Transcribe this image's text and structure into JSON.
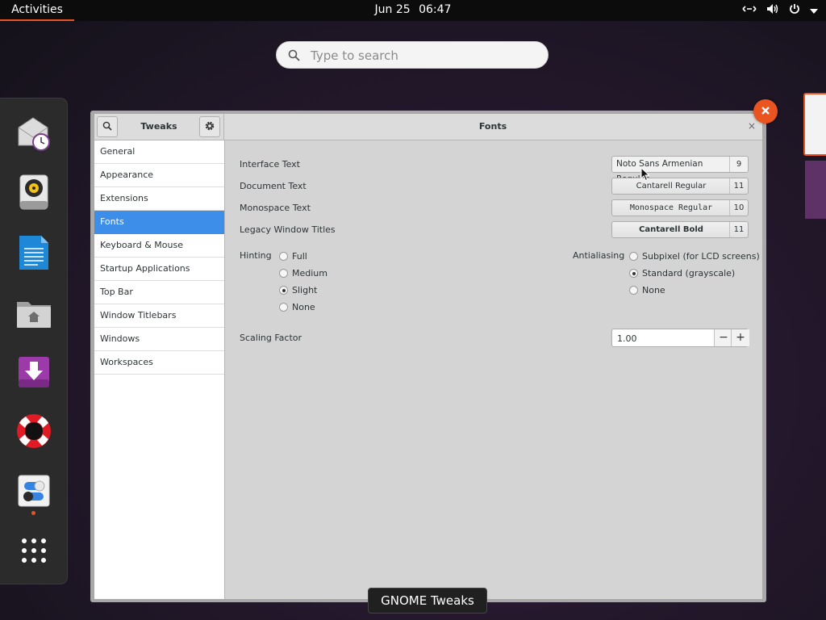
{
  "topbar": {
    "activities": "Activities",
    "date": "Jun 25",
    "time": "06:47",
    "network_icon": "network-wired-icon",
    "volume_icon": "volume-icon",
    "power_icon": "power-icon",
    "menu_icon": "chevron-down-icon"
  },
  "search": {
    "placeholder": "Type to search",
    "value": ""
  },
  "dash": {
    "items": [
      "mail-clock-icon",
      "rhythmbox-speaker-icon",
      "writer-document-icon",
      "home-folder-icon",
      "software-download-icon",
      "help-lifebuoy-icon",
      "tweaks-toggles-icon",
      "show-applications-icon"
    ]
  },
  "window": {
    "sidebar_title": "Tweaks",
    "page_title": "Fonts",
    "close_label": "×",
    "sidebar_items": [
      "General",
      "Appearance",
      "Extensions",
      "Fonts",
      "Keyboard & Mouse",
      "Startup Applications",
      "Top Bar",
      "Window Titlebars",
      "Windows",
      "Workspaces"
    ],
    "selected_index": 3,
    "fonts": {
      "interface": {
        "label": "Interface Text",
        "name": "Noto Sans Armenian Regular",
        "size": "9"
      },
      "document": {
        "label": "Document Text",
        "name": "Cantarell Regular",
        "size": "11"
      },
      "monospace": {
        "label": "Monospace Text",
        "name": "Monospace Regular",
        "size": "10"
      },
      "legacy": {
        "label": "Legacy Window Titles",
        "name": "Cantarell Bold",
        "size": "11"
      }
    },
    "hinting": {
      "label": "Hinting",
      "options": [
        "Full",
        "Medium",
        "Slight",
        "None"
      ],
      "selected": "Slight"
    },
    "antialiasing": {
      "label": "Antialiasing",
      "options": [
        "Subpixel (for LCD screens)",
        "Standard (grayscale)",
        "None"
      ],
      "selected": "Standard (grayscale)"
    },
    "scaling": {
      "label": "Scaling Factor",
      "value": "1.00",
      "minus": "−",
      "plus": "+"
    }
  },
  "tooltip": "GNOME Tweaks",
  "colors": {
    "accent": "#e95420",
    "selection": "#3d8ee9"
  }
}
